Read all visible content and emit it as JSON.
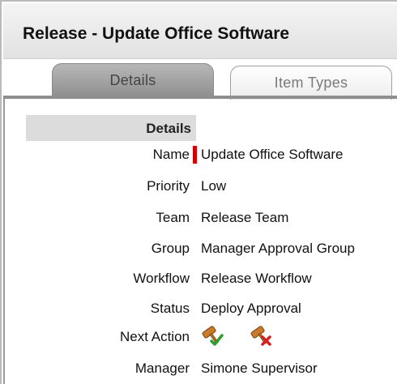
{
  "window": {
    "title": "Release - Update Office Software"
  },
  "tabs": [
    {
      "label": "Details"
    },
    {
      "label": "Item Types"
    }
  ],
  "section": {
    "header": "Details"
  },
  "fields": [
    {
      "label": "Name",
      "value": "Update Office Software",
      "required": true
    },
    {
      "label": "Priority",
      "value": "Low"
    },
    {
      "label": "Team",
      "value": "Release Team"
    },
    {
      "label": "Group",
      "value": "Manager Approval Group"
    },
    {
      "label": "Workflow",
      "value": "Release Workflow"
    },
    {
      "label": "Status",
      "value": "Deploy Approval"
    }
  ],
  "next_action": {
    "label": "Next Action",
    "actions": [
      {
        "icon": "gavel-approve-icon"
      },
      {
        "icon": "gavel-reject-icon"
      }
    ]
  },
  "manager": {
    "label": "Manager",
    "value": "Simone Supervisor"
  },
  "colors": {
    "required": "#d40000",
    "approve": "#2f9e2f",
    "reject": "#d42222",
    "gavel": "#c87a2a"
  }
}
